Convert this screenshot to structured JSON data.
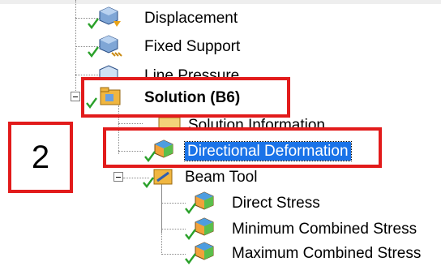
{
  "tree": {
    "items": [
      {
        "label": "Displacement",
        "icon": "displacement-icon",
        "status": "check-icon"
      },
      {
        "label": "Fixed Support",
        "icon": "fixed-support-icon",
        "status": "check-icon"
      },
      {
        "label": "Line Pressure",
        "icon": "line-pressure-icon",
        "status": "check-icon"
      },
      {
        "label": "Solution (B6)",
        "icon": "solution-folder-icon",
        "status": "check-icon"
      },
      {
        "label": "Solution Information",
        "icon": "solution-information-icon",
        "status": "check-icon"
      },
      {
        "label": "Directional Deformation",
        "icon": "result-cube-icon",
        "status": "check-icon",
        "selected": true
      },
      {
        "label": "Beam Tool",
        "icon": "beam-tool-icon",
        "status": "check-icon"
      },
      {
        "label": "Direct Stress",
        "icon": "result-cube-icon",
        "status": "check-icon"
      },
      {
        "label": "Minimum Combined Stress",
        "icon": "result-cube-icon",
        "status": "check-icon"
      },
      {
        "label": "Maximum Combined Stress",
        "icon": "result-cube-icon",
        "status": "check-icon"
      }
    ]
  },
  "annotation": {
    "step_number": "2"
  },
  "colors": {
    "highlight_box": "#e21b1b",
    "selection": "#1a73e8",
    "check": "#2aa12a"
  }
}
